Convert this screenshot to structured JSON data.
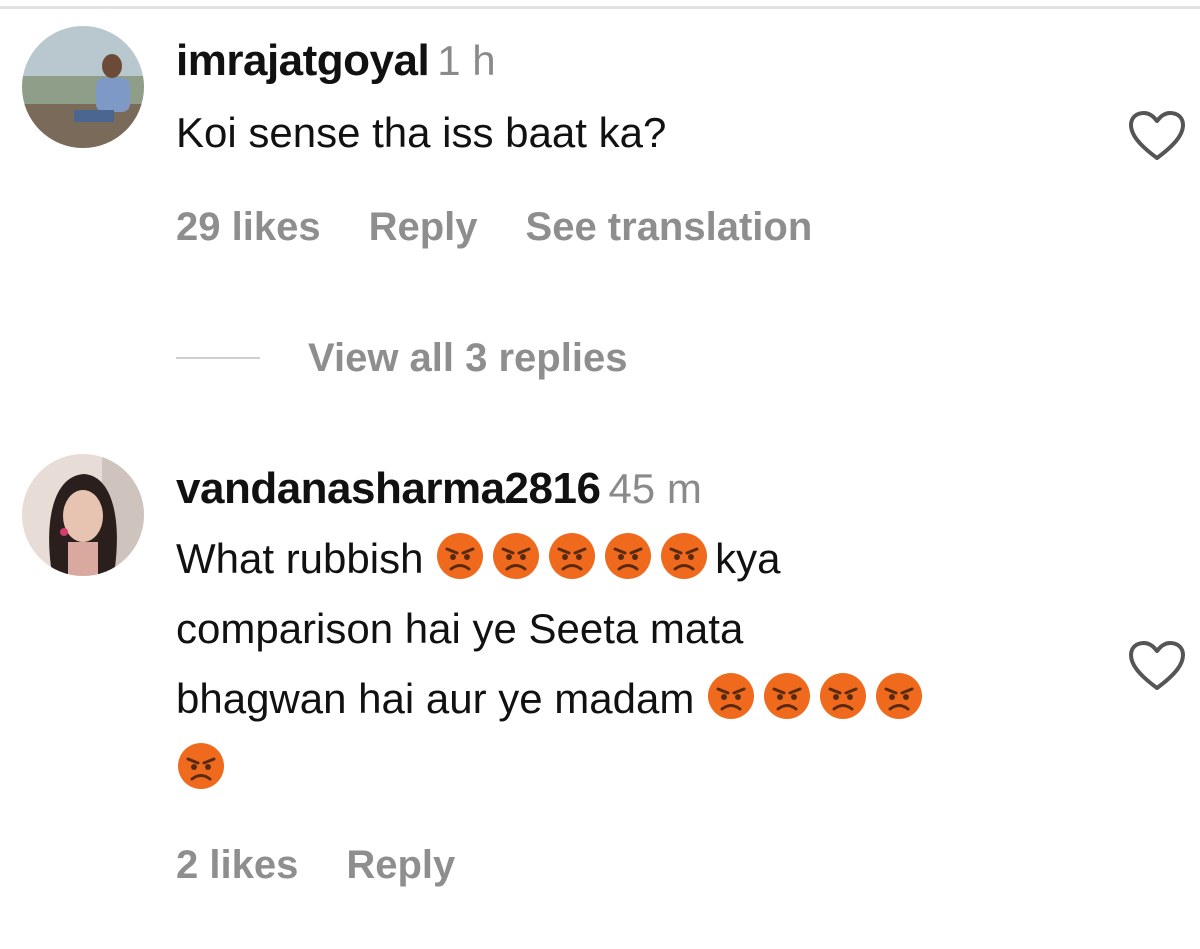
{
  "comments": [
    {
      "username": "imrajatgoyal",
      "time": "1 h",
      "lines": [
        "Koi sense tha iss baat ka?"
      ],
      "likes": "29 likes",
      "reply": "Reply",
      "translate": "See translation",
      "view_replies": "View all 3 replies"
    },
    {
      "username": "vandanasharma2816",
      "time": "45 m",
      "line1_text": "What rubbish",
      "line1_suffix": "kya",
      "line2": "comparison hai ye Seeta mata",
      "line3_text": "bhagwan hai aur ye madam",
      "likes": "2 likes",
      "reply": "Reply"
    }
  ],
  "icons": {
    "heart": "heart-outline-icon",
    "emoji": "angry-face-emoji"
  },
  "colors": {
    "primary_text": "#111111",
    "secondary_text": "#8e8e8e",
    "emoji_fill": "#f06a1d"
  }
}
